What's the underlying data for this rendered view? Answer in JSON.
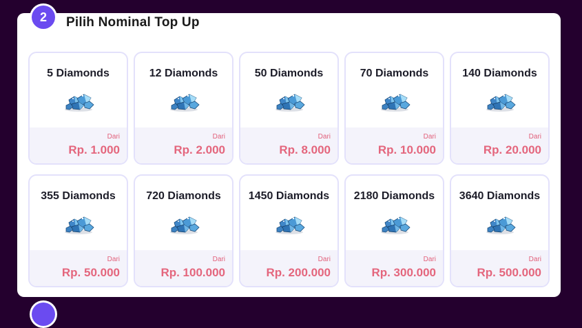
{
  "step": {
    "number": "2",
    "title": "Pilih Nominal Top Up"
  },
  "from_label": "Dari",
  "items": [
    {
      "name": "5 Diamonds",
      "price": "Rp. 1.000"
    },
    {
      "name": "12 Diamonds",
      "price": "Rp. 2.000"
    },
    {
      "name": "50 Diamonds",
      "price": "Rp. 8.000"
    },
    {
      "name": "70 Diamonds",
      "price": "Rp. 10.000"
    },
    {
      "name": "140 Diamonds",
      "price": "Rp. 20.000"
    },
    {
      "name": "355 Diamonds",
      "price": "Rp. 50.000"
    },
    {
      "name": "720 Diamonds",
      "price": "Rp. 100.000"
    },
    {
      "name": "1450 Diamonds",
      "price": "Rp. 200.000"
    },
    {
      "name": "2180 Diamonds",
      "price": "Rp. 300.000"
    },
    {
      "name": "3640 Diamonds",
      "price": "Rp. 500.000"
    }
  ],
  "icons": {
    "gem": "diamond-icon"
  },
  "colors": {
    "background": "#24002e",
    "accent": "#6b4bf0",
    "price": "#e4667d",
    "card_border": "#e3e1fb"
  }
}
